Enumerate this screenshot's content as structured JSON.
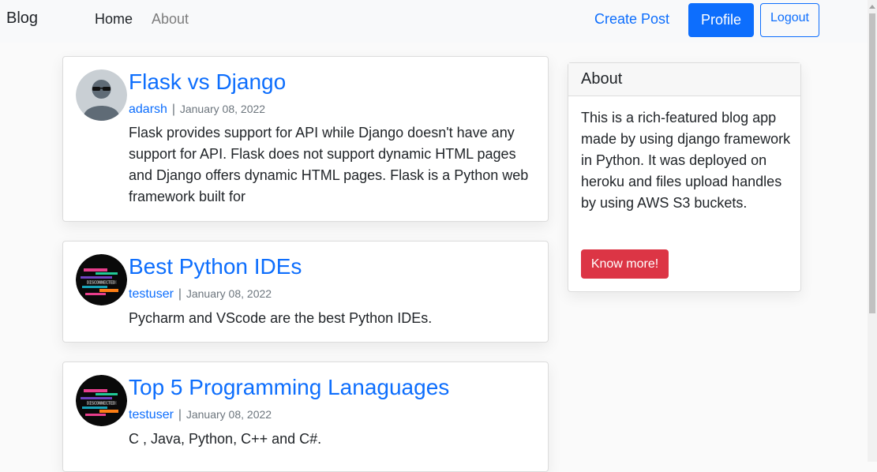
{
  "nav": {
    "brand": "Blog",
    "home": "Home",
    "about": "About",
    "create_post": "Create Post",
    "profile": "Profile",
    "logout": "Logout"
  },
  "posts": [
    {
      "title": "Flask vs Django",
      "author": "adarsh",
      "separator": "|",
      "date": "January 08, 2022",
      "content": "Flask provides support for API while Django doesn't have any support for API. Flask does not support dynamic HTML pages and Django offers dynamic HTML pages. Flask is a Python web framework built for",
      "avatar": "default-user-icon"
    },
    {
      "title": "Best Python IDEs",
      "author": "testuser",
      "separator": "|",
      "date": "January 08, 2022",
      "content": "Pycharm and VScode are the best Python IDEs.",
      "avatar": "disconnected-glitch-avatar"
    },
    {
      "title": "Top 5 Programming Lanaguages",
      "author": "testuser",
      "separator": "|",
      "date": "January 08, 2022",
      "content": "C , Java, Python, C++ and C#.",
      "avatar": "disconnected-glitch-avatar"
    }
  ],
  "sidebar": {
    "header": "About",
    "text": "This is a rich-featured blog app made by using django framework in Python. It was deployed on heroku and files upload handles by using AWS S3 buckets.",
    "button": "Know more!"
  },
  "colors": {
    "primary": "#0d6efd",
    "danger": "#dc3545",
    "navbar_bg": "#f8f9fa"
  }
}
